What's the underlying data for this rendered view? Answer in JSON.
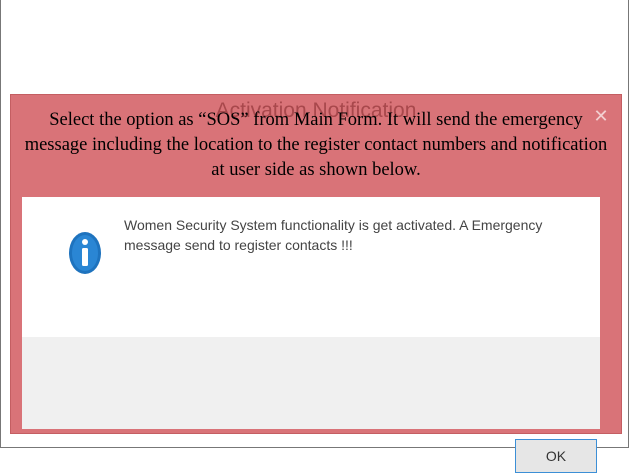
{
  "dialog": {
    "title": "Activation Notification",
    "close_glyph": "✕",
    "message": "Women Security System functionality is get activated. A Emergency message send to register contacts !!!",
    "icon": "info-icon",
    "ok_label": "OK"
  },
  "caption": {
    "text": "Select the option as “SOS” from Main Form. It will send the emergency message including the location to the register contact numbers and notification at user side as shown below."
  },
  "colors": {
    "dialog_border": "#d97378",
    "info_icon": "#1e73be",
    "ok_border": "#3c8fd6"
  }
}
